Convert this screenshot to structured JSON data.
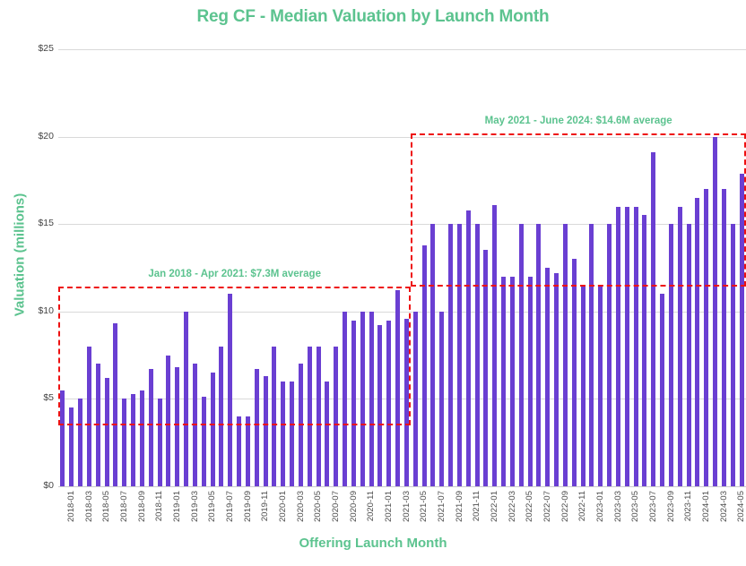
{
  "chart_data": {
    "type": "bar",
    "title": "Reg CF - Median Valuation by Launch Month",
    "xlabel": "Offering Launch Month",
    "ylabel": "Valuation (millions)",
    "ylim": [
      0,
      25
    ],
    "ytick_labels": [
      "$0",
      "$5",
      "$10",
      "$15",
      "$20",
      "$25"
    ],
    "ytick_values": [
      0,
      5,
      10,
      15,
      20,
      25
    ],
    "grid": true,
    "legend": "none",
    "bar_color": "#6a3fd2",
    "accent_color": "#5cc38f",
    "annotation_color": "#ee1111",
    "categories": [
      "2018-01",
      "2018-02",
      "2018-03",
      "2018-04",
      "2018-05",
      "2018-06",
      "2018-07",
      "2018-08",
      "2018-09",
      "2018-10",
      "2018-11",
      "2018-12",
      "2019-01",
      "2019-02",
      "2019-03",
      "2019-04",
      "2019-05",
      "2019-06",
      "2019-07",
      "2019-08",
      "2019-09",
      "2019-10",
      "2019-11",
      "2019-12",
      "2020-01",
      "2020-02",
      "2020-03",
      "2020-04",
      "2020-05",
      "2020-06",
      "2020-07",
      "2020-08",
      "2020-09",
      "2020-10",
      "2020-11",
      "2020-12",
      "2021-01",
      "2021-02",
      "2021-03",
      "2021-04",
      "2021-05",
      "2021-06",
      "2021-07",
      "2021-08",
      "2021-09",
      "2021-10",
      "2021-11",
      "2021-12",
      "2022-01",
      "2022-02",
      "2022-03",
      "2022-04",
      "2022-05",
      "2022-06",
      "2022-07",
      "2022-08",
      "2022-09",
      "2022-10",
      "2022-11",
      "2022-12",
      "2023-01",
      "2023-02",
      "2023-03",
      "2023-04",
      "2023-05",
      "2023-06",
      "2023-07",
      "2023-08",
      "2023-09",
      "2023-10",
      "2023-11",
      "2023-12",
      "2024-01",
      "2024-02",
      "2024-03",
      "2024-04",
      "2024-05",
      "2024-06"
    ],
    "tick_labels_shown": [
      "2018-01",
      "2018-03",
      "2018-05",
      "2018-07",
      "2018-09",
      "2018-11",
      "2019-01",
      "2019-03",
      "2019-05",
      "2019-07",
      "2019-09",
      "2019-11",
      "2020-01",
      "2020-03",
      "2020-05",
      "2020-07",
      "2020-09",
      "2020-11",
      "2021-01",
      "2021-03",
      "2021-05",
      "2021-07",
      "2021-09",
      "2021-11",
      "2022-01",
      "2022-03",
      "2022-05",
      "2022-07",
      "2022-09",
      "2022-11",
      "2023-01",
      "2023-03",
      "2023-05",
      "2023-07",
      "2023-09",
      "2023-11",
      "2024-01",
      "2024-03",
      "2024-05"
    ],
    "values": [
      5.5,
      4.5,
      5.0,
      8.0,
      7.0,
      6.2,
      9.3,
      5.0,
      5.3,
      5.5,
      6.7,
      5.0,
      7.5,
      6.8,
      10.0,
      7.0,
      5.1,
      6.5,
      8.0,
      11.0,
      4.0,
      4.0,
      6.7,
      6.3,
      8.0,
      6.0,
      6.0,
      7.0,
      8.0,
      8.0,
      6.0,
      8.0,
      10.0,
      9.5,
      10.0,
      10.0,
      9.2,
      9.5,
      11.2,
      9.6,
      10.0,
      13.8,
      15.0,
      10.0,
      15.0,
      15.0,
      15.8,
      15.0,
      13.5,
      16.1,
      12.0,
      12.0,
      15.0,
      12.0,
      15.0,
      12.5,
      12.2,
      15.0,
      13.0,
      11.5,
      15.0,
      11.5,
      15.0,
      16.0,
      16.0,
      16.0,
      15.5,
      19.1,
      11.0,
      15.0,
      16.0,
      15.0,
      16.5,
      17.0,
      20.0,
      17.0,
      15.0,
      17.9
    ],
    "annotations": [
      {
        "label": "Jan 2018 - Apr 2021: $7.3M average",
        "period_start": "2018-01",
        "period_end": "2021-04",
        "average": 7.3,
        "box_top_value": 11.4,
        "box_bottom_value": 3.5
      },
      {
        "label": "May 2021 - June 2024: $14.6M average",
        "period_start": "2021-05",
        "period_end": "2024-06",
        "average": 14.6,
        "box_top_value": 20.2,
        "box_bottom_value": 11.4
      }
    ]
  }
}
